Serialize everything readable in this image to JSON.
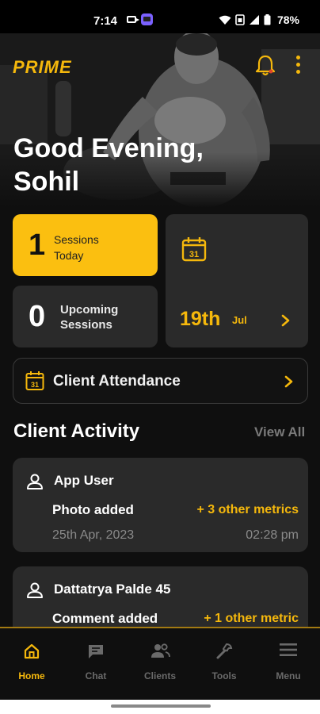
{
  "status_bar": {
    "time": "7:14",
    "battery": "78%"
  },
  "header": {
    "logo": "PRIME",
    "greeting_line1": "Good Evening,",
    "greeting_line2": "Sohil"
  },
  "stats": {
    "sessions_today_count": "1",
    "sessions_today_label_1": "Sessions",
    "sessions_today_label_2": "Today",
    "upcoming_count": "0",
    "upcoming_label_1": "Upcoming",
    "upcoming_label_2": "Sessions",
    "date_day": "19th",
    "date_month": "Jul",
    "calendar_icon_number": "31"
  },
  "attendance": {
    "label": "Client Attendance",
    "calendar_icon_number": "31"
  },
  "activity": {
    "title": "Client Activity",
    "view_all": "View All",
    "items": [
      {
        "name": "App User",
        "description": "Photo added",
        "metric": "+ 3 other metrics",
        "date": "25th Apr, 2023",
        "time": "02:28 pm"
      },
      {
        "name": "Dattatrya Palde 45",
        "description": "Comment added",
        "metric": "+ 1 other metric",
        "date": "",
        "time": ""
      }
    ]
  },
  "nav": {
    "items": [
      {
        "label": "Home",
        "icon": "home-icon",
        "active": true
      },
      {
        "label": "Chat",
        "icon": "chat-icon",
        "active": false
      },
      {
        "label": "Clients",
        "icon": "clients-icon",
        "active": false
      },
      {
        "label": "Tools",
        "icon": "wrench-icon",
        "active": false
      },
      {
        "label": "Menu",
        "icon": "menu-icon",
        "active": false
      }
    ]
  },
  "colors": {
    "accent": "#f5b80c",
    "background": "#0f0f0f",
    "card": "#2a2a2a"
  }
}
